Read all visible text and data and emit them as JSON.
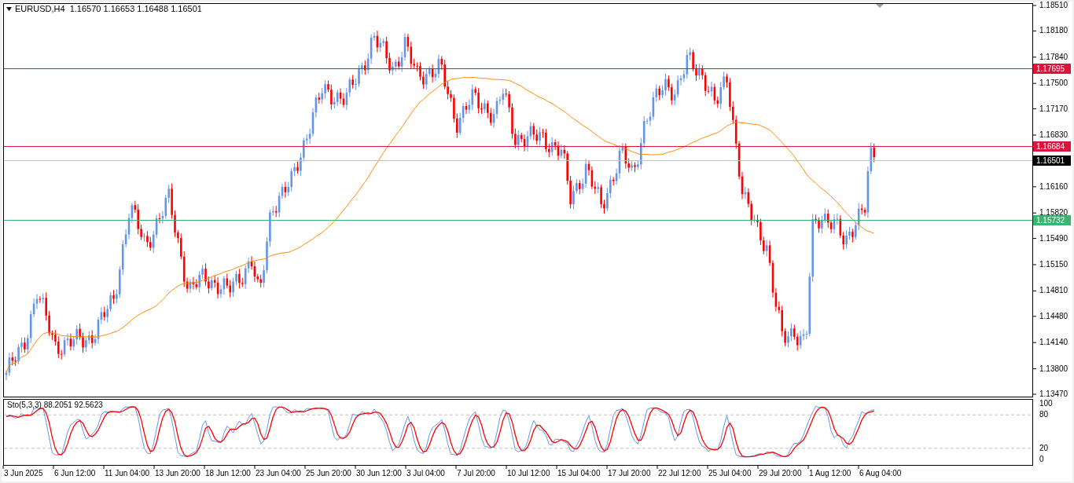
{
  "header": {
    "text": "EURUSD,H4  1.16570 1.16653 1.16488 1.16501"
  },
  "price_axis": {
    "ticks": [
      "1.18510",
      "1.18180",
      "1.17840",
      "1.17500",
      "1.17170",
      "1.16830",
      "1.16160",
      "1.15820",
      "1.15490",
      "1.15150",
      "1.14810",
      "1.14480",
      "1.14140",
      "1.13800",
      "1.13470"
    ]
  },
  "price_lines": [
    {
      "label": "1.17695",
      "kind": "level",
      "color": "#dc143c"
    },
    {
      "label": "1.16684",
      "kind": "level",
      "color": "#dc143c"
    },
    {
      "label": "1.16501",
      "kind": "bid",
      "color": "#000000"
    },
    {
      "label": "1.15732",
      "kind": "level",
      "color": "#3cb371"
    }
  ],
  "stochastic": {
    "label": "Sto(5,3,3) 88.2051 92.5623",
    "levels": [
      "100",
      "80",
      "20",
      "0"
    ]
  },
  "time_axis": [
    "3 Jun 2025",
    "6 Jun 12:00",
    "11 Jun 04:00",
    "13 Jun 20:00",
    "18 Jun 12:00",
    "23 Jun 04:00",
    "25 Jun 20:00",
    "30 Jun 12:00",
    "3 Jul 04:00",
    "7 Jul 20:00",
    "10 Jul 12:00",
    "15 Jul 04:00",
    "17 Jul 20:00",
    "22 Jul 12:00",
    "25 Jul 04:00",
    "29 Jul 20:00",
    "1 Aug 12:00",
    "6 Aug 04:00"
  ]
}
